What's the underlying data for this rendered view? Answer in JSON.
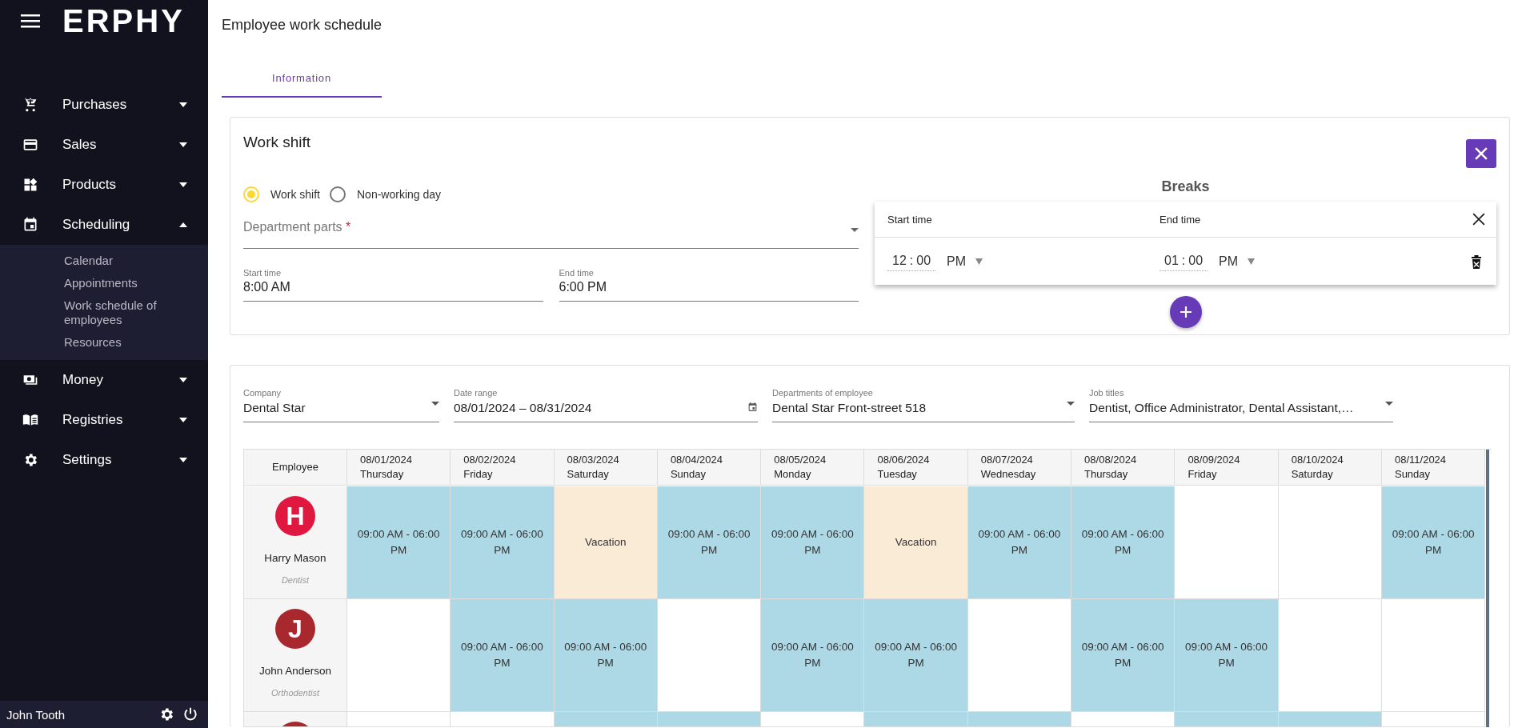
{
  "sidebar": {
    "logo": "ERPHY",
    "items": [
      {
        "label": "Purchases",
        "expanded": false
      },
      {
        "label": "Sales",
        "expanded": false
      },
      {
        "label": "Products",
        "expanded": false
      },
      {
        "label": "Scheduling",
        "expanded": true,
        "children": [
          {
            "label": "Calendar"
          },
          {
            "label": "Appointments"
          },
          {
            "label": "Work schedule of employees"
          },
          {
            "label": "Resources"
          }
        ]
      },
      {
        "label": "Money",
        "expanded": false
      },
      {
        "label": "Registries",
        "expanded": false
      },
      {
        "label": "Settings",
        "expanded": false
      }
    ],
    "user": "John Tooth"
  },
  "page": {
    "title": "Employee work schedule",
    "tabs": [
      {
        "label": "Information",
        "selected": true
      }
    ]
  },
  "work_shift": {
    "title": "Work shift",
    "options": [
      {
        "label": "Work shift",
        "selected": true
      },
      {
        "label": "Non-working day",
        "selected": false
      }
    ],
    "department": {
      "label": "Department parts",
      "required": true,
      "required_mark": "*"
    },
    "start_time": {
      "label": "Start time",
      "value": "8:00 AM"
    },
    "end_time": {
      "label": "End time",
      "value": "6:00 PM"
    },
    "breaks": {
      "title": "Breaks",
      "columns": [
        "Start time",
        "End time"
      ],
      "rows": [
        {
          "start": {
            "hour": "12",
            "sep": ":",
            "minute": "00",
            "period": "PM"
          },
          "end": {
            "hour": "01",
            "sep": ":",
            "minute": "00",
            "period": "PM"
          }
        }
      ]
    }
  },
  "filters": [
    {
      "label": "Company",
      "value": "Dental Star",
      "kind": "select"
    },
    {
      "label": "Date range",
      "value": "08/01/2024  – 08/31/2024",
      "kind": "date"
    },
    {
      "label": "Departments of employee",
      "value": "Dental Star Front-street 518",
      "kind": "select"
    },
    {
      "label": "Job titles",
      "value": "Dentist, Office Administrator, Dental Assistant,…",
      "kind": "select"
    }
  ],
  "schedule": {
    "employee_header": "Employee",
    "days": [
      {
        "date": "08/01/2024",
        "weekday": "Thursday"
      },
      {
        "date": "08/02/2024",
        "weekday": "Friday"
      },
      {
        "date": "08/03/2024",
        "weekday": "Saturday"
      },
      {
        "date": "08/04/2024",
        "weekday": "Sunday"
      },
      {
        "date": "08/05/2024",
        "weekday": "Monday"
      },
      {
        "date": "08/06/2024",
        "weekday": "Tuesday"
      },
      {
        "date": "08/07/2024",
        "weekday": "Wednesday"
      },
      {
        "date": "08/08/2024",
        "weekday": "Thursday"
      },
      {
        "date": "08/09/2024",
        "weekday": "Friday"
      },
      {
        "date": "08/10/2024",
        "weekday": "Saturday"
      },
      {
        "date": "08/11/2024",
        "weekday": "Sunday"
      }
    ],
    "rows": [
      {
        "initial": "H",
        "color": "#e0173f",
        "name": "Harry Mason",
        "job": "Dentist",
        "cells": [
          {
            "kind": "shift",
            "text": "09:00 AM - 06:00 PM"
          },
          {
            "kind": "shift",
            "text": "09:00 AM - 06:00 PM"
          },
          {
            "kind": "vacation",
            "text": "Vacation"
          },
          {
            "kind": "shift",
            "text": "09:00 AM - 06:00 PM"
          },
          {
            "kind": "shift",
            "text": "09:00 AM - 06:00 PM"
          },
          {
            "kind": "vacation",
            "text": "Vacation"
          },
          {
            "kind": "shift",
            "text": "09:00 AM - 06:00 PM"
          },
          {
            "kind": "shift",
            "text": "09:00 AM - 06:00 PM"
          },
          {
            "kind": "empty"
          },
          {
            "kind": "empty"
          },
          {
            "kind": "shift",
            "text": "09:00 AM - 06:00 PM"
          }
        ]
      },
      {
        "initial": "J",
        "color": "#a8282d",
        "name": "John Anderson",
        "job": "Orthodentist",
        "cells": [
          {
            "kind": "empty"
          },
          {
            "kind": "shift",
            "text": "09:00 AM - 06:00 PM"
          },
          {
            "kind": "shift",
            "text": "09:00 AM - 06:00 PM"
          },
          {
            "kind": "empty"
          },
          {
            "kind": "shift",
            "text": "09:00 AM - 06:00 PM"
          },
          {
            "kind": "shift",
            "text": "09:00 AM - 06:00 PM"
          },
          {
            "kind": "empty"
          },
          {
            "kind": "shift",
            "text": "09:00 AM - 06:00 PM"
          },
          {
            "kind": "shift",
            "text": "09:00 AM - 06:00 PM"
          },
          {
            "kind": "empty"
          },
          {
            "kind": "empty"
          }
        ]
      },
      {
        "color": "#a8282d",
        "cells": [
          {
            "kind": "empty"
          },
          {
            "kind": "empty"
          },
          {
            "kind": "shift"
          },
          {
            "kind": "shift"
          },
          {
            "kind": "empty"
          },
          {
            "kind": "shift"
          },
          {
            "kind": "shift"
          },
          {
            "kind": "empty"
          },
          {
            "kind": "shift"
          },
          {
            "kind": "shift"
          },
          {
            "kind": "empty"
          }
        ]
      }
    ]
  }
}
